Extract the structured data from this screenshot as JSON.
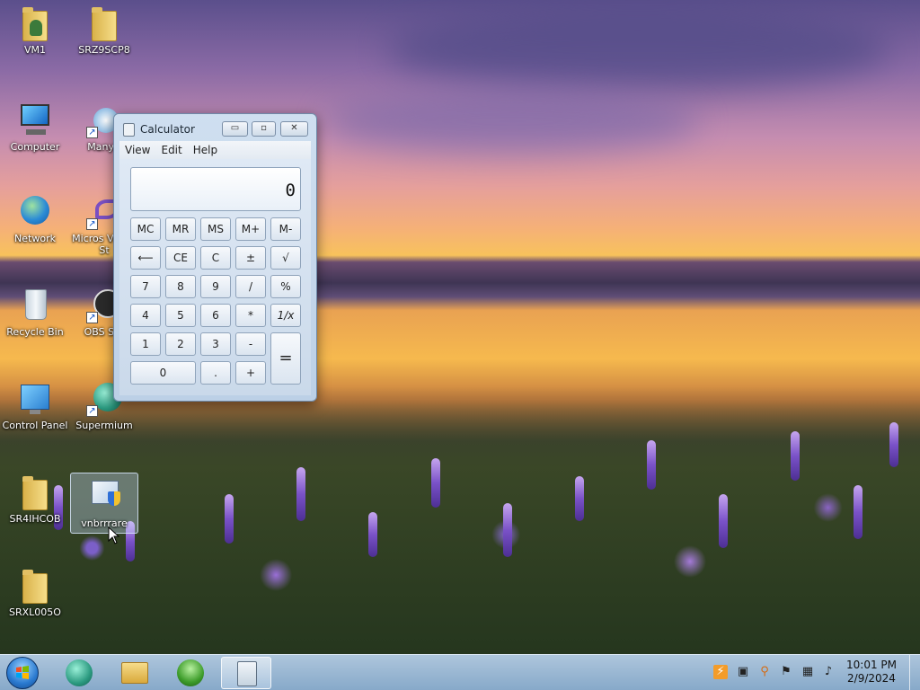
{
  "desktop": {
    "icons": [
      {
        "label": "VM1"
      },
      {
        "label": "SRZ9SCP8"
      },
      {
        "label": "Computer"
      },
      {
        "label": "ManyC"
      },
      {
        "label": "Network"
      },
      {
        "label": "Micros Visual St"
      },
      {
        "label": "Recycle Bin"
      },
      {
        "label": "OBS Stu"
      },
      {
        "label": "Control Panel"
      },
      {
        "label": "Supermium"
      },
      {
        "label": "SR4IHCOB"
      },
      {
        "label": "vnbrrrare"
      },
      {
        "label": "SRXL005O"
      }
    ]
  },
  "calculator": {
    "title": "Calculator",
    "menu": [
      "View",
      "Edit",
      "Help"
    ],
    "display": "0",
    "window_buttons": {
      "minimize": "▭",
      "maximize": "▫",
      "close": "✕"
    },
    "keys": {
      "mc": "MC",
      "mr": "MR",
      "ms": "MS",
      "mplus": "M+",
      "mminus": "M-",
      "back": "⟵",
      "ce": "CE",
      "c": "C",
      "plusminus": "±",
      "sqrt": "√",
      "n7": "7",
      "n8": "8",
      "n9": "9",
      "div": "/",
      "pct": "%",
      "n4": "4",
      "n5": "5",
      "n6": "6",
      "mul": "*",
      "recip": "1/x",
      "n1": "1",
      "n2": "2",
      "n3": "3",
      "sub": "-",
      "eq": "=",
      "n0": "0",
      "dot": ".",
      "add": "+"
    }
  },
  "taskbar": {
    "clock_time": "10:01 PM",
    "clock_date": "2/9/2024"
  }
}
